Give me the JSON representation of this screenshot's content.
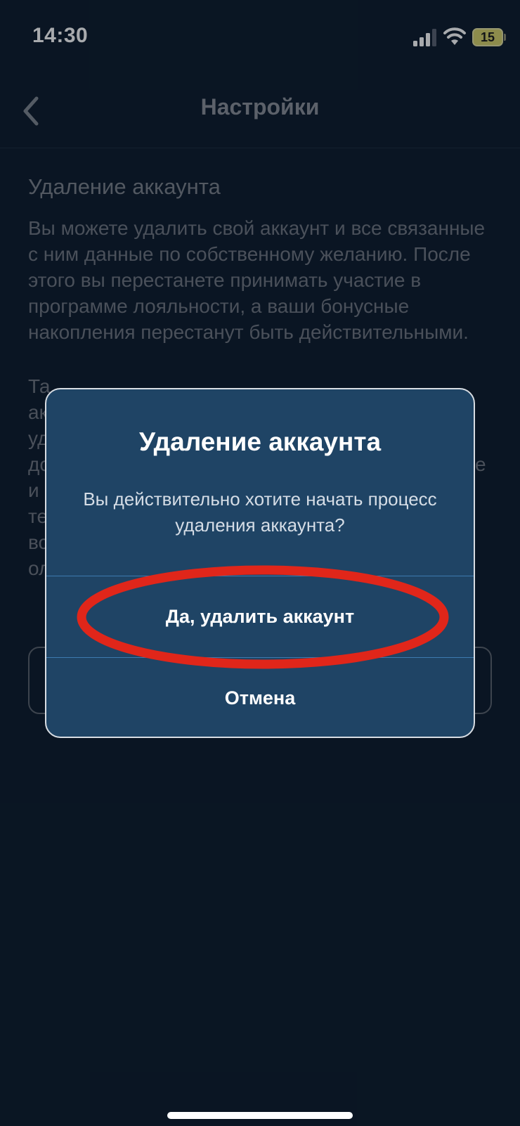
{
  "status_bar": {
    "time": "14:30",
    "battery": "15",
    "icons": [
      "signal-icon",
      "wifi-icon",
      "battery-icon"
    ]
  },
  "nav": {
    "title": "Настройки",
    "back_icon": "chevron-left-icon"
  },
  "content": {
    "section_title": "Удаление аккаунта",
    "paragraph_1": "Вы можете удалить свой аккаунт и все связанные с ним данные по собственному желанию. После этого вы перестанете принимать участие в программе лояльности, а ваши бонусные накопления перестанут быть действительными.",
    "paragraph_2_visible_fragments": [
      "Та",
      "ак",
      "уд",
      "дс",
      "и",
      "те",
      "вс",
      "ол",
      "е"
    ]
  },
  "alert": {
    "title": "Удаление аккаунта",
    "message": "Вы действительно хотите начать процесс удаления аккаунта?",
    "confirm_label": "Да, удалить аккаунт",
    "cancel_label": "Отмена"
  },
  "colors": {
    "background": "#0d1b2b",
    "alert_background": "#1f4465",
    "annotation": "#e0261a"
  }
}
